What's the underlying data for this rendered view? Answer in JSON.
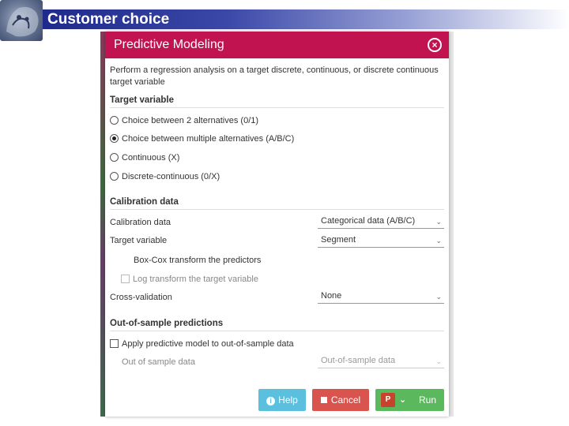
{
  "slide": {
    "title": "Customer choice"
  },
  "modal": {
    "title": "Predictive Modeling",
    "description": "Perform a regression analysis on a target discrete, continuous, or discrete continuous target variable"
  },
  "target_variable": {
    "heading": "Target variable",
    "options": [
      {
        "label": "Choice between 2 alternatives (0/1)",
        "selected": false
      },
      {
        "label": "Choice between multiple alternatives (A/B/C)",
        "selected": true
      },
      {
        "label": "Continuous (X)",
        "selected": false
      },
      {
        "label": "Discrete-continuous (0/X)",
        "selected": false
      }
    ]
  },
  "calibration": {
    "heading": "Calibration data",
    "calibration_label": "Calibration data",
    "calibration_value": "Categorical data (A/B/C)",
    "target_label": "Target variable",
    "target_value": "Segment",
    "boxcox_label": "Box-Cox transform the predictors",
    "logtransform_label": "Log transform the target variable",
    "crossval_label": "Cross-validation",
    "crossval_value": "None"
  },
  "out_of_sample": {
    "heading": "Out-of-sample predictions",
    "apply_label": "Apply predictive model to out-of-sample data",
    "data_label": "Out of sample data",
    "data_value": "Out-of-sample data"
  },
  "buttons": {
    "help": "Help",
    "cancel": "Cancel",
    "run": "Run",
    "ppt": "P"
  },
  "colors": {
    "header": "#c1134f",
    "help": "#5bc0de",
    "cancel": "#d9534f",
    "run": "#5cb85c"
  }
}
